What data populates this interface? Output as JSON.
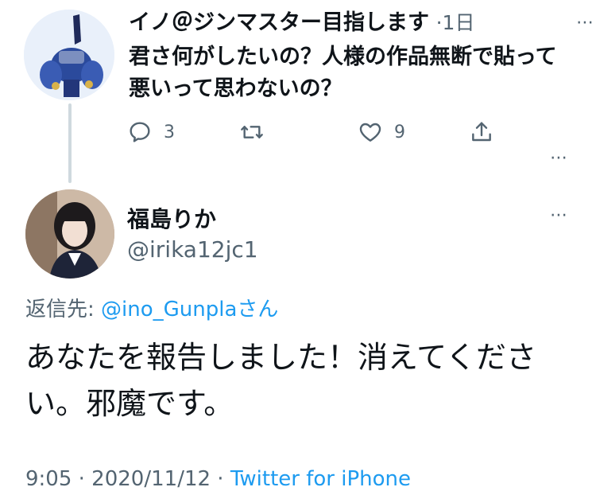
{
  "tweet1": {
    "name": "イノ＠ジンマスター目指します",
    "time_sep": "·",
    "time": "1日",
    "text": "君さ何がしたいの？人様の作品無断で貼って悪いって思わないの？",
    "reply_count": "3",
    "like_count": "9",
    "avatar_icon": "robot-figure-photo"
  },
  "tweet2": {
    "name": "福島りか",
    "handle": "@irika12jc1",
    "reply_label": "返信先:",
    "reply_user": "@ino_Gunpla",
    "reply_suffix": "さん",
    "text": "あなたを報告しました！消えてください。邪魔です。",
    "footer_time": "9:05 · 2020/11/12 ·",
    "footer_source": "Twitter for iPhone",
    "avatar_icon": "person-photo"
  },
  "icons": {
    "more": "⋯"
  },
  "colors": {
    "accent": "#1d9bf0",
    "muted": "#536471",
    "thread_line": "#cfd9de"
  }
}
